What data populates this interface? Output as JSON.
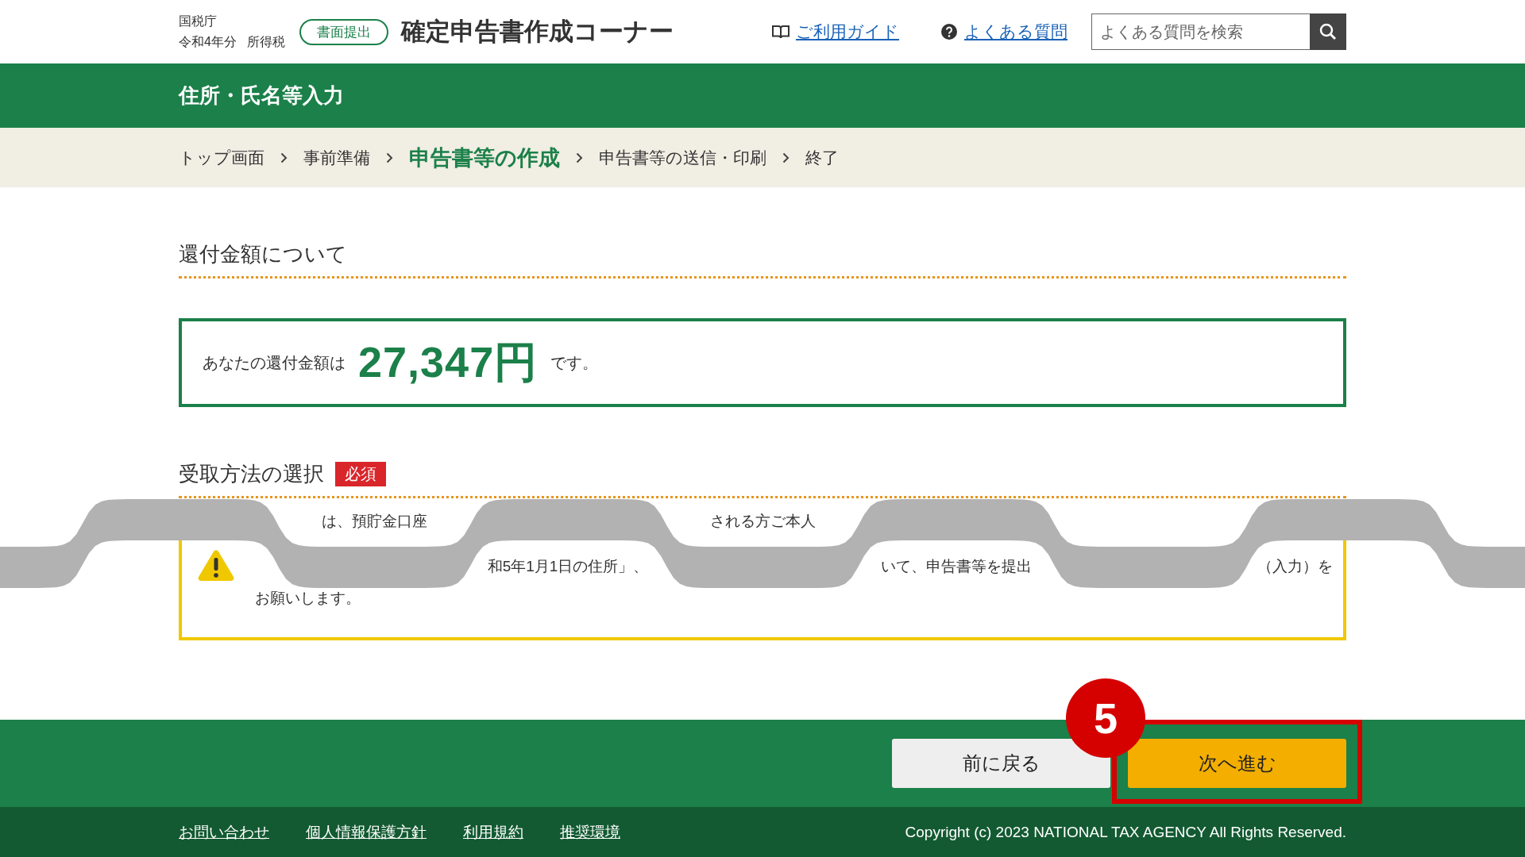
{
  "header": {
    "agency": "国税庁",
    "year": "令和4年分",
    "tax": "所得税",
    "filing_badge": "書面提出",
    "title": "確定申告書作成コーナー",
    "links": [
      {
        "label": "ご利用ガイド",
        "kind": "guide"
      },
      {
        "label": "よくある質問",
        "kind": "faq"
      }
    ],
    "search": {
      "placeholder": "よくある質問を検索"
    }
  },
  "page_title": "住所・氏名等入力",
  "breadcrumb": [
    {
      "label": "トップ画面",
      "selected": false
    },
    {
      "label": "事前準備",
      "selected": false
    },
    {
      "label": "申告書等の作成",
      "selected": true
    },
    {
      "label": "申告書等の送信・印刷",
      "selected": false
    },
    {
      "label": "終了",
      "selected": false
    }
  ],
  "refund": {
    "heading": "還付金額について",
    "prefix": "あなたの還付金額は",
    "amount": "27,347円",
    "suffix": "です。"
  },
  "receipt": {
    "heading": "受取方法の選択",
    "required_badge": "必須",
    "note_fragments": [
      "は、預貯金口座",
      "される方ご本人"
    ],
    "warning": {
      "fragments": [
        "和5年1月1日の住所」、",
        "いて、申告書等を提出",
        "（入力）を"
      ],
      "last_line": "お願いします。"
    }
  },
  "buttons": [
    {
      "label": "前に戻る",
      "kind": "back",
      "highlighted": false
    },
    {
      "label": "次へ進む",
      "kind": "next",
      "highlighted": true
    }
  ],
  "step_marker": "5",
  "footer": {
    "links": [
      "お問い合わせ",
      "個人情報保護方針",
      "利用規約",
      "推奨環境"
    ],
    "copyright": "Copyright (c) 2023 NATIONAL TAX AGENCY All Rights Reserved."
  }
}
